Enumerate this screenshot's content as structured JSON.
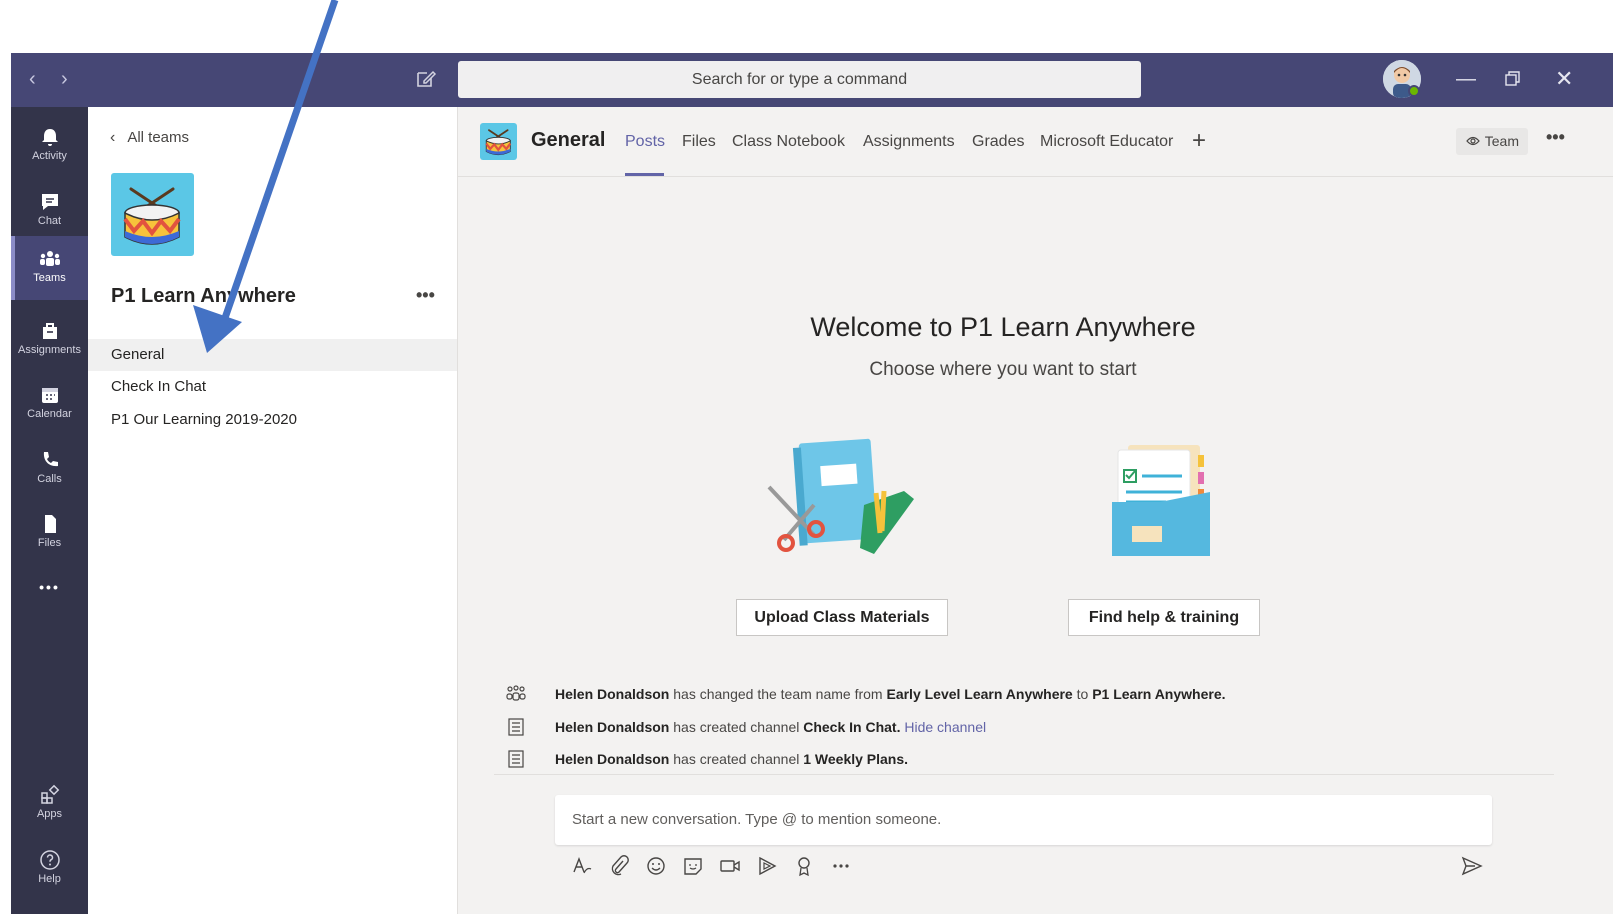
{
  "titlebar": {
    "search_placeholder": "Search for or type a command",
    "back_icon": "chevron-left-icon",
    "forward_icon": "chevron-right-icon",
    "compose_icon": "compose-icon",
    "window_controls": [
      "minimize-icon",
      "restore-icon",
      "close-icon"
    ],
    "presence": "available",
    "brand_color": "#464775"
  },
  "rail": {
    "items": [
      {
        "label": "Activity",
        "icon": "bell-icon"
      },
      {
        "label": "Chat",
        "icon": "chat-icon"
      },
      {
        "label": "Teams",
        "icon": "teams-icon",
        "active": true
      },
      {
        "label": "Assignments",
        "icon": "assignments-icon"
      },
      {
        "label": "Calendar",
        "icon": "calendar-icon"
      },
      {
        "label": "Calls",
        "icon": "phone-icon"
      },
      {
        "label": "Files",
        "icon": "file-icon"
      }
    ],
    "more": "•••",
    "bottom": [
      {
        "label": "Apps",
        "icon": "apps-icon"
      },
      {
        "label": "Help",
        "icon": "help-icon"
      }
    ]
  },
  "panel": {
    "back_label": "All teams",
    "team_name": "P1 Learn Anywhere",
    "team_more": "•••",
    "channels": [
      {
        "name": "General",
        "active": true
      },
      {
        "name": "Check In Chat"
      },
      {
        "name": "P1 Our Learning 2019-2020"
      }
    ]
  },
  "header": {
    "channel_title": "General",
    "tabs": [
      "Posts",
      "Files",
      "Class Notebook",
      "Assignments",
      "Grades",
      "Microsoft Educator"
    ],
    "active_tab": "Posts",
    "add_tab": "+",
    "team_button": "Team",
    "more": "•••",
    "accent_color": "#6264a7"
  },
  "welcome": {
    "title": "Welcome to P1 Learn Anywhere",
    "subtitle": "Choose where you want to start",
    "upload_button": "Upload Class Materials",
    "help_button": "Find help & training"
  },
  "activity": [
    {
      "user": "Helen Donaldson",
      "text1": "has changed the team name from",
      "old": "Early Level Learn Anywhere",
      "text2": "to",
      "new": "P1 Learn Anywhere."
    },
    {
      "user": "Helen Donaldson",
      "text1": "has created channel",
      "channel": "Check In Chat.",
      "link": "Hide channel"
    },
    {
      "user": "Helen Donaldson",
      "text1": "has created channel",
      "channel": "1 Weekly Plans."
    }
  ],
  "composer": {
    "placeholder": "Start a new conversation. Type @ to mention someone.",
    "tools": [
      "format-icon",
      "attach-icon",
      "emoji-icon",
      "sticker-icon",
      "meet-icon",
      "stream-icon",
      "praise-icon",
      "more-icon"
    ],
    "send_icon": "send-icon"
  }
}
